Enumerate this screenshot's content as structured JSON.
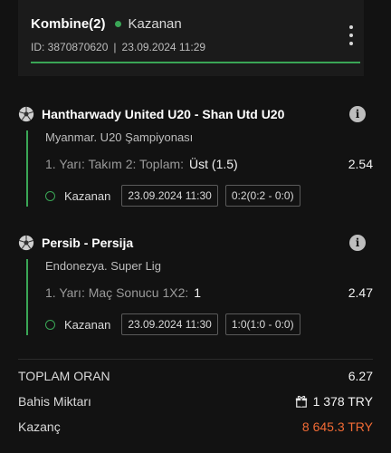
{
  "header": {
    "title": "Kombine(2)",
    "status": "Kazanan",
    "id_text": "ID: 3870870620",
    "separator": "|",
    "datetime": "23.09.2024 11:29"
  },
  "events": [
    {
      "name": "Hantharwady United U20 - Shan Utd U20",
      "league": "Myanmar. U20 Şampiyonası",
      "market": "1. Yarı: Takım 2: Toplam:",
      "selection": "Üst (1.5)",
      "odds": "2.54",
      "result": "Kazanan",
      "date": "23.09.2024 11:30",
      "score": "0:2(0:2 - 0:0)"
    },
    {
      "name": "Persib - Persija",
      "league": "Endonezya. Super Lig",
      "market": "1. Yarı: Maç Sonucu 1X2:",
      "selection": "1",
      "odds": "2.47",
      "result": "Kazanan",
      "date": "23.09.2024 11:30",
      "score": "1:0(1:0 - 0:0)"
    }
  ],
  "summary": {
    "total_odds_label": "TOPLAM ORAN",
    "total_odds_value": "6.27",
    "stake_label": "Bahis Miktarı",
    "stake_value": "1 378 TRY",
    "winnings_label": "Kazanç",
    "winnings_value": "8 645.3 TRY"
  },
  "colors": {
    "accent": "#3aa656",
    "winnings": "#f26b35",
    "background": "#121212"
  },
  "icons": [
    "kebab-menu-icon",
    "soccer-ball-icon",
    "info-icon",
    "status-ring-icon",
    "gift-icon"
  ]
}
